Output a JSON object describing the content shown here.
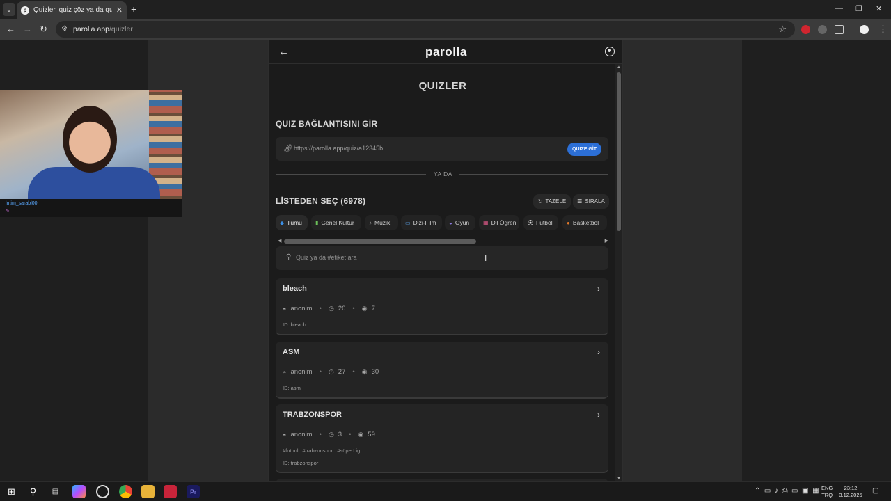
{
  "browser": {
    "tab_title": "Quizler, quiz çöz ya da quiz oluş",
    "url_host": "parolla.app",
    "url_path": "/quizler"
  },
  "webcam": {
    "chat_user": "lntim_sarabl00"
  },
  "app": {
    "logo": "parolla",
    "page_title": "QUIZLER",
    "link_section_title": "QUIZ BAĞLANTISINI GİR",
    "link_placeholder": "https://parolla.app/quiz/a12345b",
    "go_button": "QUIZE GİT",
    "divider": "YA DA",
    "list_title": "LİSTEDEN SEÇ (6978)",
    "refresh_button": "TAZELE",
    "sort_button": "SIRALA",
    "categories": [
      {
        "label": "Tümü",
        "icon": "diamond-icon",
        "color": "#3b8fe6"
      },
      {
        "label": "Genel Kültür",
        "icon": "books-icon",
        "color": "#6bbf59"
      },
      {
        "label": "Müzik",
        "icon": "music-note-icon",
        "color": "#999999"
      },
      {
        "label": "Dizi-Film",
        "icon": "tv-icon",
        "color": "#5aa0e6"
      },
      {
        "label": "Oyun",
        "icon": "gamepad-icon",
        "color": "#8b7be0"
      },
      {
        "label": "Dil Öğren",
        "icon": "language-icon",
        "color": "#e05a8a"
      },
      {
        "label": "Futbol",
        "icon": "football-icon",
        "color": "#dddddd"
      },
      {
        "label": "Basketbol",
        "icon": "basketball-icon",
        "color": "#e0782a"
      }
    ],
    "search_placeholder": "Quiz ya da #etiket ara",
    "quizzes": [
      {
        "title": "bleach",
        "author": "anonim",
        "questions": "20",
        "views": "7",
        "id": "ID: bleach",
        "tags": []
      },
      {
        "title": "ASM",
        "author": "anonim",
        "questions": "27",
        "views": "30",
        "id": "ID: asm",
        "tags": []
      },
      {
        "title": "TRABZONSPOR",
        "author": "anonim",
        "questions": "3",
        "views": "59",
        "id": "ID: trabzonspor",
        "tags": [
          "#futbol",
          "#trabzonspor",
          "#süperLig"
        ]
      }
    ]
  },
  "taskbar": {
    "lang_top": "ENG",
    "lang_bottom": "TRQ",
    "time": "23:12",
    "date": "3.12.2025"
  },
  "colors": {
    "accent": "#2c6fd6",
    "background": "#1b1b1b",
    "card": "#242424"
  }
}
